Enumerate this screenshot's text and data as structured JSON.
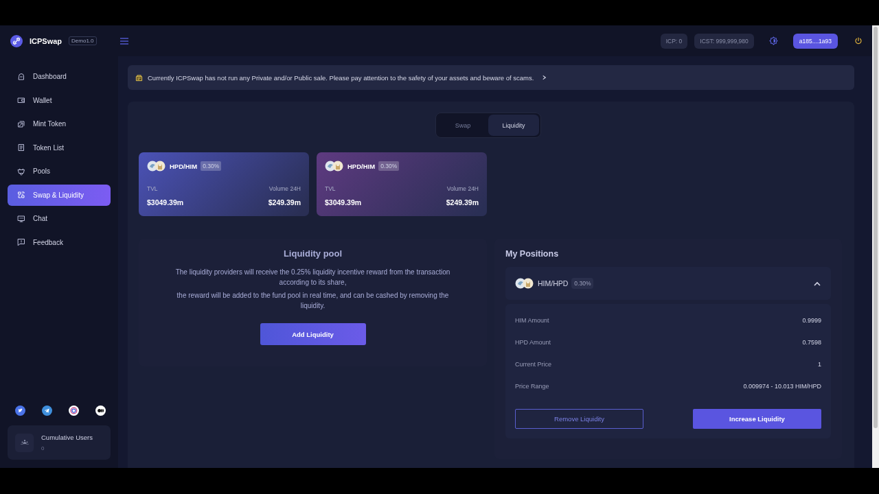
{
  "brand": {
    "name": "ICPSwap",
    "version": "Demo1.0"
  },
  "header": {
    "balances": [
      "ICP: 0",
      "ICST: 999,999,980"
    ],
    "account": "a185....1a93"
  },
  "sidebar": {
    "items": [
      {
        "label": "Dashboard",
        "kind": "dashboard",
        "selected": false
      },
      {
        "label": "Wallet",
        "kind": "wallet",
        "selected": false
      },
      {
        "label": "Mint Token",
        "kind": "mint",
        "selected": false
      },
      {
        "label": "Token List",
        "kind": "list",
        "selected": false
      },
      {
        "label": "Pools",
        "kind": "pools",
        "selected": false
      },
      {
        "label": "Swap & Liquidity",
        "kind": "swap",
        "selected": true
      },
      {
        "label": "Chat",
        "kind": "chat",
        "selected": false
      },
      {
        "label": "Feedback",
        "kind": "feedback",
        "selected": false
      }
    ],
    "socials": [
      {
        "kind": "twitter"
      },
      {
        "kind": "telegram"
      },
      {
        "kind": "dfinity"
      },
      {
        "kind": "medium"
      }
    ],
    "stats": {
      "label": "Cumulative Users",
      "value": "0"
    }
  },
  "notice": {
    "text": "Currently ICPSwap has not run any Private and/or Public sale. Please pay attention to the safety of your assets and beware of scams."
  },
  "mode_tabs": [
    {
      "label": "Swap",
      "selected": false
    },
    {
      "label": "Liquidity",
      "selected": true
    }
  ],
  "pools": [
    {
      "pair": "HPD/HIM",
      "fee": "0.30%",
      "tvl_label": "TVL",
      "tvl": "$3049.39m",
      "volume_label": "Volume 24H",
      "volume": "$249.39m",
      "color": "#4b52b6"
    },
    {
      "pair": "HPD/HIM",
      "fee": "0.30%",
      "tvl_label": "TVL",
      "tvl": "$3049.39m",
      "volume_label": "Volume 24H",
      "volume": "$249.39m",
      "color": "#5e3a80"
    }
  ],
  "liquidity_pool": {
    "title": "Liquidity pool",
    "lines": [
      "The liquidity providers will receive the 0.25% liquidity incentive reward from the transaction according to its share,",
      "the reward will be added to the fund pool in real time, and can be cashed by removing the liquidity."
    ],
    "button": "Add Liquidity"
  },
  "positions": {
    "title": "My Positions",
    "items": [
      {
        "pair": "HIM/HPD",
        "fee": "0.30%",
        "expanded": true,
        "details": [
          {
            "label": "HIM Amount",
            "value": "0.9999"
          },
          {
            "label": "HPD Amount",
            "value": "0.7598"
          },
          {
            "label": "Current Price",
            "value": "1"
          },
          {
            "label": "Price Range",
            "value": "0.009974 - 10.013 HIM/HPD"
          }
        ],
        "buttons": [
          {
            "label": "Remove Liquidity",
            "kind": "outline"
          },
          {
            "label": "Increase Liquidity",
            "kind": "filled"
          }
        ]
      }
    ]
  }
}
